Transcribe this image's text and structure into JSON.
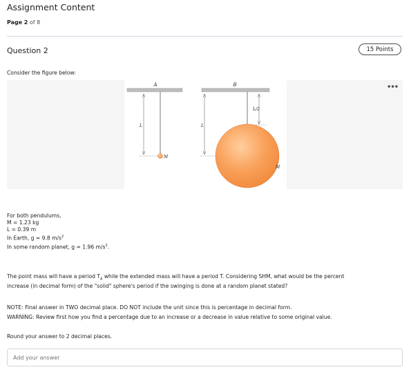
{
  "header": {
    "title": "Assignment Content",
    "page_label": "Page",
    "page_current": "2",
    "page_sep": "of",
    "page_total": "8"
  },
  "question": {
    "title": "Question 2",
    "points": "15 Points",
    "intro": "Consider the figure below:",
    "more_icon": "•••"
  },
  "figure": {
    "label_a": "A",
    "label_b": "B",
    "label_l": "L",
    "label_half_l": "L/2",
    "label_m": "M",
    "colors": {
      "sphere": "#f7954a",
      "sphere_light": "#ffd7b0",
      "ceiling": "#b8b8b8"
    }
  },
  "given": {
    "line1": "For both pendulums,",
    "line2": "M = 1.23 kg",
    "line3": "L = 0.39 m",
    "line4_pre": "In Earth, g = 9.8 m/s",
    "line4_sup": "2",
    "line5_pre": "In some random planet, g = 1.96 m/s",
    "line5_sup": "2",
    "line5_post": "."
  },
  "body": {
    "para1_pre": "The point mass will have a period T",
    "para1_sub": "A",
    "para1_post": " while the extended mass will have a period T. Considering SHM, what would be the percent",
    "para1_line2": "increase (in decimal form) of the \"solid\" sphere's period if the swinging is done at a random planet stated?",
    "note": "NOTE: Final answer in TWO decimal place. DO NOT include the unit since this is percentage in decimal form.",
    "warning": "WARNING: Review first how you find a percentage due to an increase or a decrease in value relative to some original value.",
    "round": "Round your answer to 2 decimal places."
  },
  "answer": {
    "placeholder": "Add your answer"
  }
}
